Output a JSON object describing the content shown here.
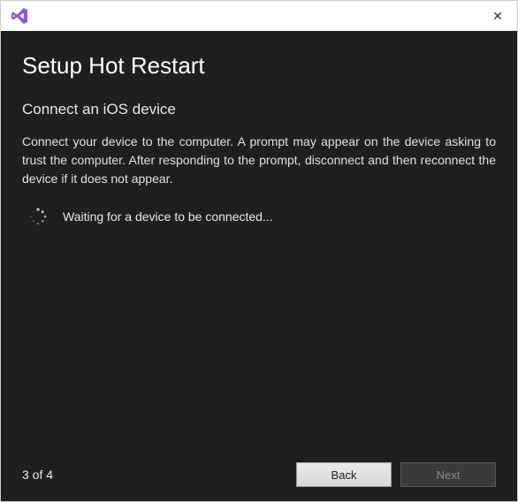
{
  "window": {
    "close_symbol": "✕"
  },
  "main": {
    "heading": "Setup Hot Restart",
    "subheading": "Connect an iOS device",
    "instructions": "Connect your device to the computer. A prompt may appear on the device asking to trust the computer. After responding to the prompt, disconnect and then reconnect the device if it does not appear.",
    "status_text": "Waiting for a device to be connected..."
  },
  "footer": {
    "page_indicator": "3 of 4",
    "back_label": "Back",
    "next_label": "Next",
    "next_enabled": false
  },
  "colors": {
    "content_bg": "#1f1f1f",
    "accent": "#8f55d6"
  }
}
